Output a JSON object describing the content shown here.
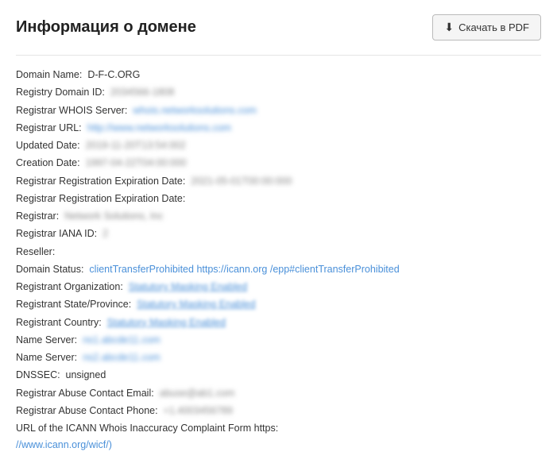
{
  "header": {
    "title": "Информация о домене",
    "download_label": "Скачать в PDF"
  },
  "whois": {
    "domain_name_label": "Domain Name:",
    "domain_name_value": "D-F-C.ORG",
    "registry_id_label": "Registry Domain ID:",
    "registry_id_value": "2034566-1808",
    "registrar_whois_label": "Registrar WHOIS Server:",
    "registrar_whois_value": "whois.networksolutions.com",
    "registrar_url_label": "Registrar URL:",
    "registrar_url_value": "http://www.networksolutions.com",
    "updated_date_label": "Updated Date:",
    "updated_date_value": "2019-11-20T13:54:002",
    "creation_date_label": "Creation Date:",
    "creation_date_value": "1997-04-22T04:00:000",
    "expiration_date_label_1": "Registrar Registration Expiration Date:",
    "expiration_date_value_1": "2021-05-01T00:00:000",
    "expiration_date_label_2": "Registrar Registration Expiration Date:",
    "registrar_label": "Registrar:",
    "registrar_value": "Network Solutions, Inc",
    "iana_id_label": "Registrar IANA ID:",
    "iana_id_value": "2",
    "reseller_label": "Reseller:",
    "domain_status_label": "Domain Status:",
    "domain_status_value": "clientTransferProhibited https://icann.org /epp#clientTransferProhibited",
    "registrant_org_label": "Registrant Organization:",
    "registrant_org_value": "Statutory Masking Enabled",
    "registrant_state_label": "Registrant State/Province:",
    "registrant_state_value": "Statutory Masking Enabled",
    "registrant_country_label": "Registrant Country:",
    "registrant_country_value": "Statutory Masking Enabled",
    "name_server_1_label": "Name Server:",
    "name_server_1_value": "ns1.abcde11.com",
    "name_server_2_label": "Name Server:",
    "name_server_2_value": "ns2.abcde11.com",
    "dnssec_label": "DNSSEC:",
    "dnssec_value": "unsigned",
    "abuse_email_label": "Registrar Abuse Contact Email:",
    "abuse_email_value": "abuse@ab1.com",
    "abuse_phone_label": "Registrar Abuse Contact Phone:",
    "abuse_phone_value": "+1.4003456789",
    "icann_url_label": "URL of the ICANN Whois Inaccuracy Complaint Form https:",
    "icann_url_value": "//www.icann.org/wicf/)"
  }
}
